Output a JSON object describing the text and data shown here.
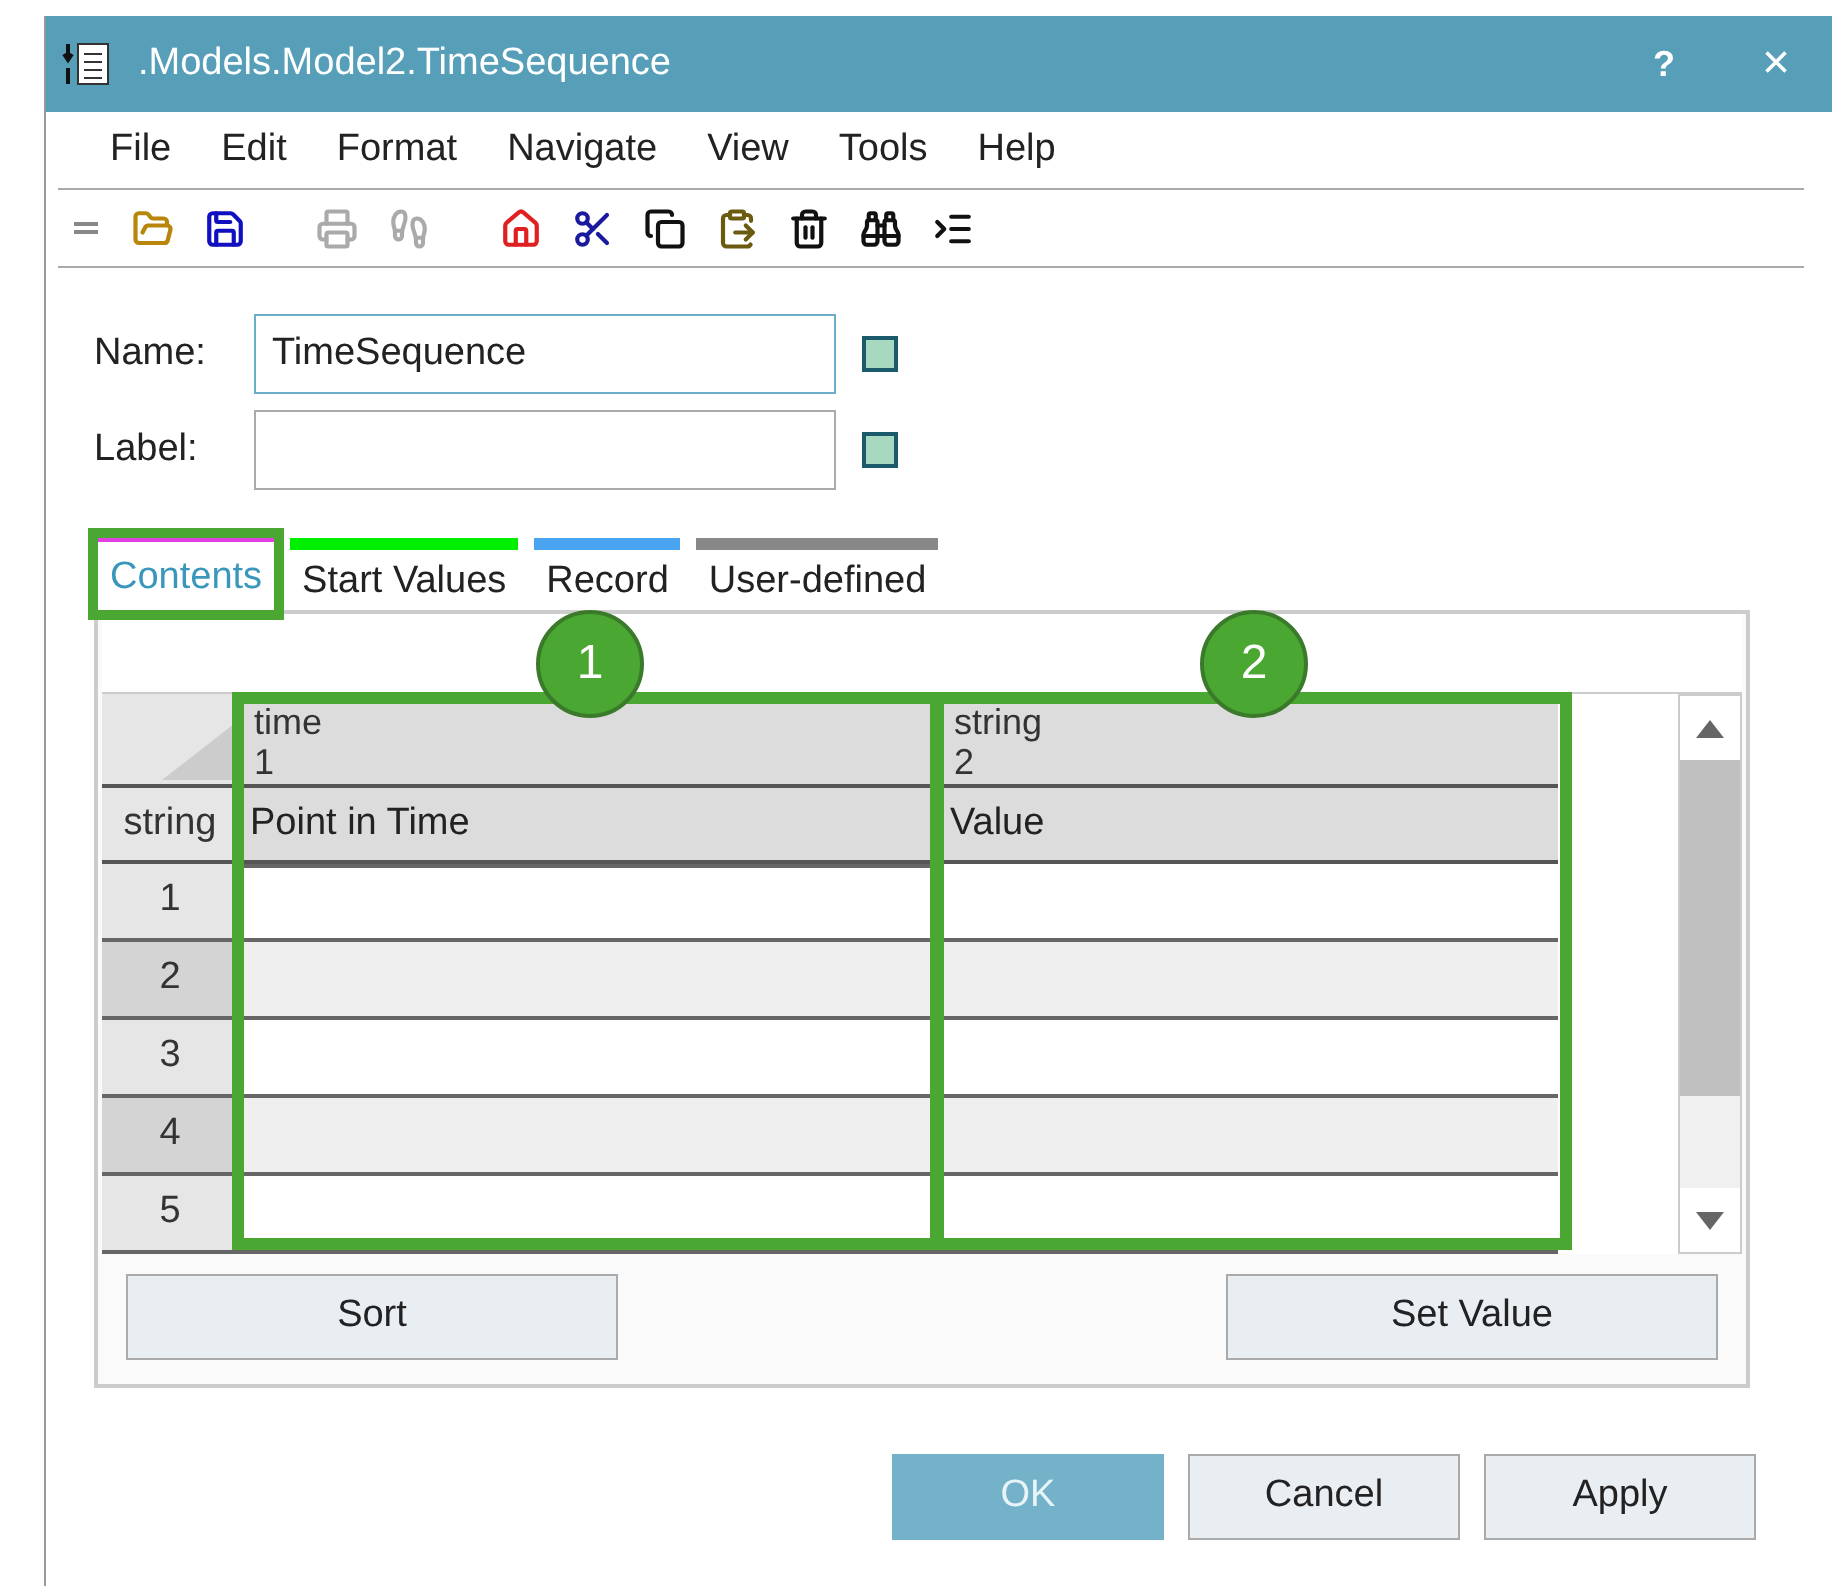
{
  "window": {
    "title": ".Models.Model2.TimeSequence",
    "help": "?",
    "close": "×"
  },
  "menu": [
    {
      "label": "File"
    },
    {
      "label": "Edit"
    },
    {
      "label": "Format"
    },
    {
      "label": "Navigate"
    },
    {
      "label": "View"
    },
    {
      "label": "Tools"
    },
    {
      "label": "Help"
    }
  ],
  "toolbar": [
    {
      "kind": "open",
      "disabled": false
    },
    {
      "kind": "save",
      "disabled": false
    },
    {
      "kind": "print",
      "disabled": true
    },
    {
      "kind": "footprints",
      "disabled": true
    },
    {
      "kind": "home",
      "disabled": false
    },
    {
      "kind": "cut",
      "disabled": false
    },
    {
      "kind": "copy",
      "disabled": false
    },
    {
      "kind": "paste",
      "disabled": false
    },
    {
      "kind": "delete",
      "disabled": false
    },
    {
      "kind": "find",
      "disabled": false
    },
    {
      "kind": "indent",
      "disabled": false
    }
  ],
  "fields": [
    {
      "label": "Name:",
      "value": "TimeSequence",
      "focused": true
    },
    {
      "label": "Label:",
      "focused": false
    }
  ],
  "tabs": [
    {
      "label": "Contents",
      "selected": true,
      "highlighted": true,
      "color": "#e040e0"
    },
    {
      "label": "Start Values",
      "selected": false,
      "color": "#00ee00"
    },
    {
      "label": "Record",
      "selected": false,
      "color": "#4aa3f0"
    },
    {
      "label": "User-defined",
      "selected": false,
      "color": "#888888"
    }
  ],
  "table": {
    "corner": "string",
    "columns": [
      {
        "type": "time",
        "index": "1",
        "name": "Point in Time"
      },
      {
        "type": "string",
        "index": "2",
        "name": "Value"
      }
    ],
    "rows": [
      {
        "label": "1"
      },
      {
        "label": "2"
      },
      {
        "label": "3"
      },
      {
        "label": "4"
      },
      {
        "label": "5"
      }
    ]
  },
  "callouts": [
    {
      "label": "1"
    },
    {
      "label": "2"
    }
  ],
  "panel_buttons": [
    "Sort",
    "Set Value"
  ],
  "buttons": [
    {
      "label": "OK",
      "primary": true
    },
    {
      "label": "Cancel",
      "primary": false
    },
    {
      "label": "Apply",
      "primary": false
    }
  ]
}
